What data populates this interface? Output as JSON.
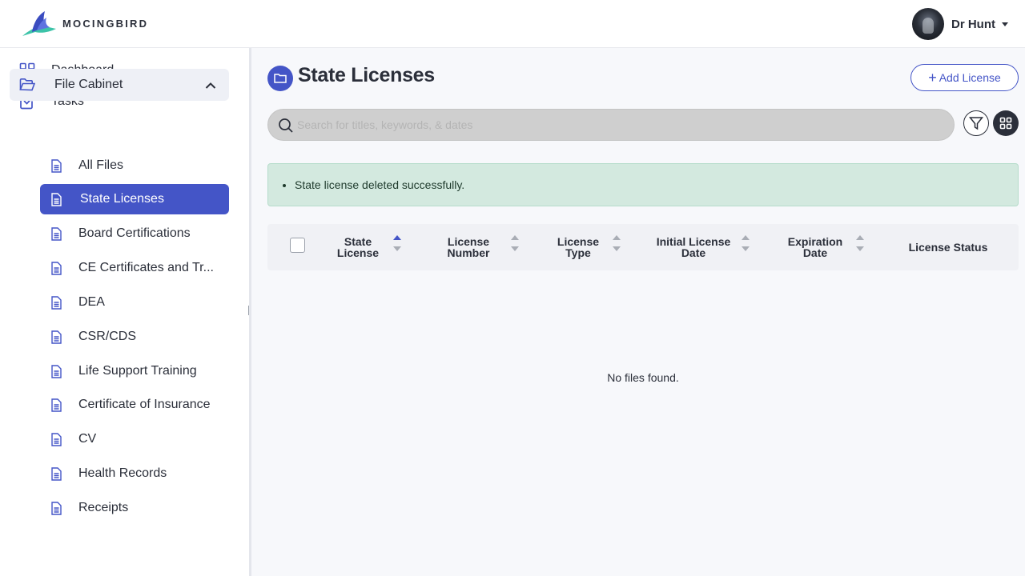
{
  "header": {
    "brand": "MOCINGBIRD",
    "user_name": "Dr Hunt"
  },
  "sidebar": {
    "top_items": [
      {
        "label": "Dashboard",
        "icon": "dashboard-grid-icon"
      },
      {
        "label": "Tasks",
        "icon": "checkbox-icon"
      }
    ],
    "file_cabinet": {
      "label": "File Cabinet",
      "icon": "folder-open-icon",
      "expanded": true
    },
    "sub_items": [
      {
        "label": "All Files"
      },
      {
        "label": "State Licenses",
        "active": true
      },
      {
        "label": "Board Certifications"
      },
      {
        "label": "CE Certificates and Tr..."
      },
      {
        "label": "DEA"
      },
      {
        "label": "CSR/CDS"
      },
      {
        "label": "Life Support Training"
      },
      {
        "label": "Certificate of Insurance"
      },
      {
        "label": "CV"
      },
      {
        "label": "Health Records"
      },
      {
        "label": "Receipts"
      }
    ]
  },
  "main": {
    "title": "State Licenses",
    "add_button": "Add License",
    "search_placeholder": "Search for titles, keywords, & dates",
    "alert_message": "State license deleted successfully.",
    "columns": [
      {
        "line1": "State",
        "line2": "License",
        "sort": "asc"
      },
      {
        "line1": "License",
        "line2": "Number",
        "sort": "none"
      },
      {
        "line1": "License",
        "line2": "Type",
        "sort": "none"
      },
      {
        "line1": "Initial License",
        "line2": "Date",
        "sort": "none"
      },
      {
        "line1": "Expiration",
        "line2": "Date",
        "sort": "none"
      },
      {
        "line1": "License Status",
        "line2": "",
        "sort": null
      }
    ],
    "empty_message": "No files found."
  },
  "colors": {
    "accent": "#4455c7",
    "alert_bg": "#d3e9df",
    "dark": "#2b2f3a"
  }
}
